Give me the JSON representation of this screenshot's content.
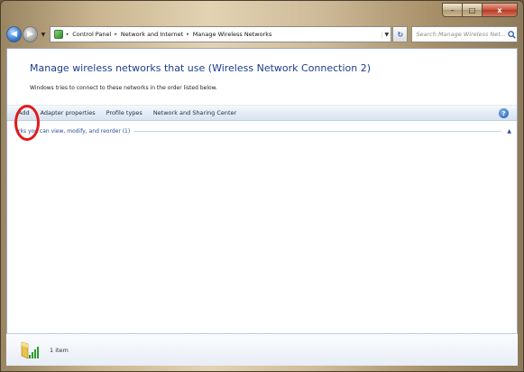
{
  "window": {
    "caption": {
      "minimize": "–",
      "maximize": "□",
      "close": "x"
    }
  },
  "nav": {
    "back_glyph": "◀",
    "forward_glyph": "▶",
    "refresh_glyph": "↻",
    "breadcrumb": [
      "Control Panel",
      "Network and Internet",
      "Manage Wireless Networks"
    ],
    "separator": "▸",
    "search_placeholder": "Search Manage Wireless Net...",
    "address_icon": "control-panel-icon",
    "search_icon": "search-icon"
  },
  "main": {
    "title": "Manage wireless networks that use (Wireless Network Connection 2)",
    "subtitle": "Windows tries to connect to these networks in the order listed below."
  },
  "toolbar": {
    "items": [
      "Add",
      "Adapter properties",
      "Profile types",
      "Network and Sharing Center"
    ],
    "help_label": "?"
  },
  "list": {
    "group_header": "rks you can view, modify, and reorder (1)",
    "collapse_glyph": "▲"
  },
  "statusbar": {
    "count_text": "1 item",
    "icon": "wireless-network-icon"
  },
  "colors": {
    "title": "#1e3c8c",
    "link": "#2450a0",
    "highlight": "#e01a1a"
  }
}
